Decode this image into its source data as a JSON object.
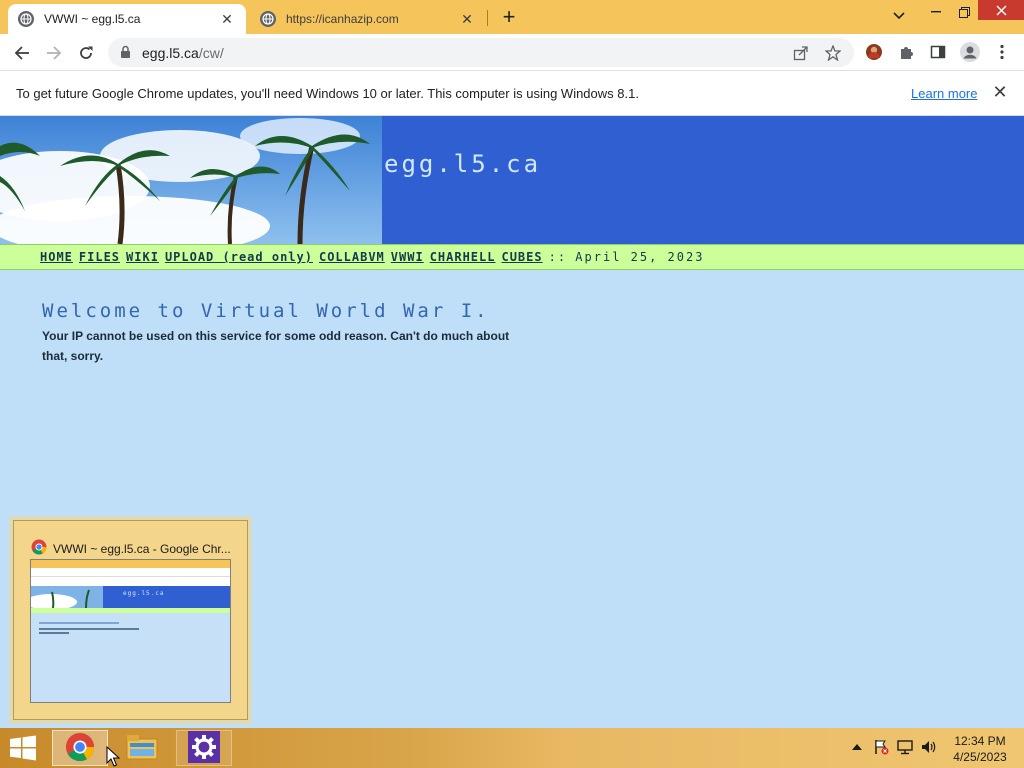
{
  "browser": {
    "tabs": [
      {
        "title": "VWWI ~ egg.l5.ca",
        "active": true
      },
      {
        "title": "https://icanhazip.com",
        "active": false
      }
    ],
    "newtab_label": "+",
    "url_host": "egg.l5.ca",
    "url_path": "/cw/",
    "infobar": {
      "message": "To get future Google Chrome updates, you'll need Windows 10 or later. This computer is using Windows 8.1.",
      "link": "Learn more",
      "close": "✕"
    }
  },
  "site": {
    "title": "egg.l5.ca",
    "nav": [
      "HOME",
      "FILES",
      "WIKI",
      "UPLOAD (read only)",
      "COLLABVM",
      "VWWI",
      "CHARHELL",
      "CUBES"
    ],
    "date_sep": "::",
    "date": "April 25, 2023",
    "welcome": "Welcome to Virtual World War I.",
    "message": "Your IP cannot be used on this service for some odd reason. Can't do much about that, sorry."
  },
  "taskbar": {
    "preview_title": "VWWI ~ egg.l5.ca - Google Chr...",
    "thumb_site_title": "egg.l5.ca",
    "apps": [
      "chrome-icon",
      "file-explorer-icon",
      "settings-icon"
    ],
    "clock_time": "12:34 PM",
    "clock_date": "4/25/2023"
  },
  "colors": {
    "tabstrip": "#f5c55c",
    "banner": "#2f5fd0",
    "navbar": "#ccff99",
    "page_bg": "#bfdef8",
    "close_button": "#c83a2e"
  }
}
